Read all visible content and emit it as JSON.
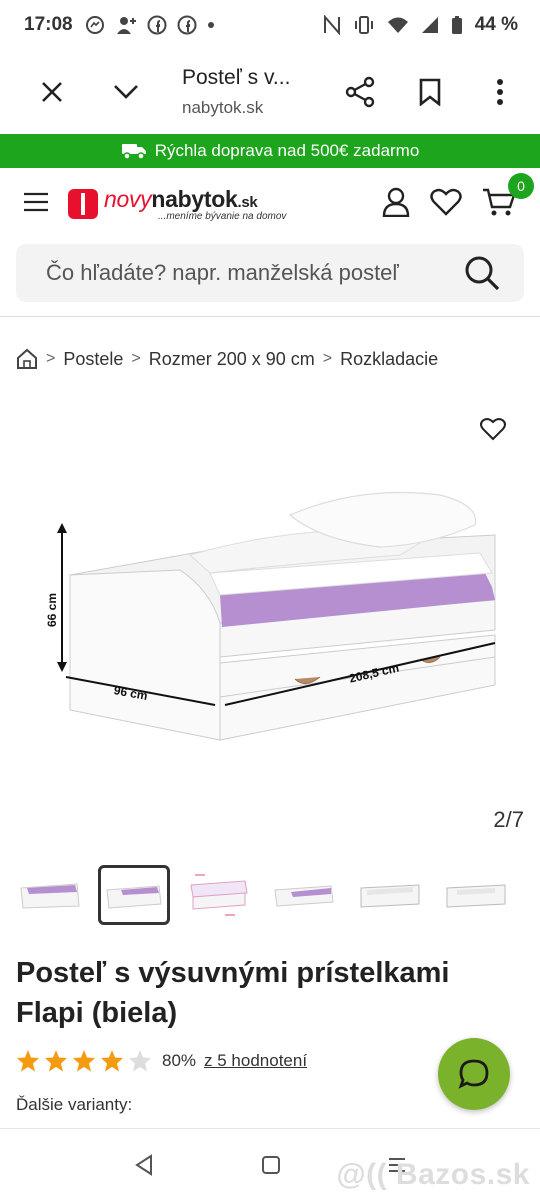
{
  "status": {
    "time": "17:08",
    "battery": "44 %",
    "left_icons": [
      "messenger-icon",
      "add-contact-icon",
      "facebook-icon",
      "facebook-icon",
      "dot-icon"
    ],
    "right_icons": [
      "nfc-icon",
      "vibrate-icon",
      "wifi-icon",
      "signal-icon",
      "battery-icon"
    ]
  },
  "browser": {
    "title": "Posteľ s v...",
    "domain": "nabytok.sk"
  },
  "promo": {
    "text": "Rýchla doprava nad 500€ zadarmo"
  },
  "logo": {
    "novy": "novy",
    "nabytok": "nabytok",
    "tld": ".sk",
    "tagline": "...meníme bývanie na domov"
  },
  "cart": {
    "count": "0"
  },
  "search": {
    "placeholder": "Čo hľadáte? napr. manželská posteľ"
  },
  "breadcrumb": {
    "items": [
      "Postele",
      "Rozmer 200 x 90 cm",
      "Rozkladacie"
    ]
  },
  "gallery": {
    "counter": "2/7",
    "dimensions": {
      "height": "66 cm",
      "depth": "96 cm",
      "width": "208,5 cm"
    }
  },
  "product": {
    "title": "Posteľ s výsuvnými prístelkami Flapi (biela)",
    "rating_stars": 4,
    "rating_max": 5,
    "rating_pct": "80%",
    "rating_link": "z 5 hodnotení",
    "variants_label": "Ďalšie varianty:"
  },
  "watermark": "@(( Bazos.sk",
  "colors": {
    "promo_green": "#1da51d",
    "brand_red": "#e8112d",
    "star_orange": "#f39c12",
    "chat_green": "#7ab32b",
    "mattress_purple": "#b68fd1"
  }
}
